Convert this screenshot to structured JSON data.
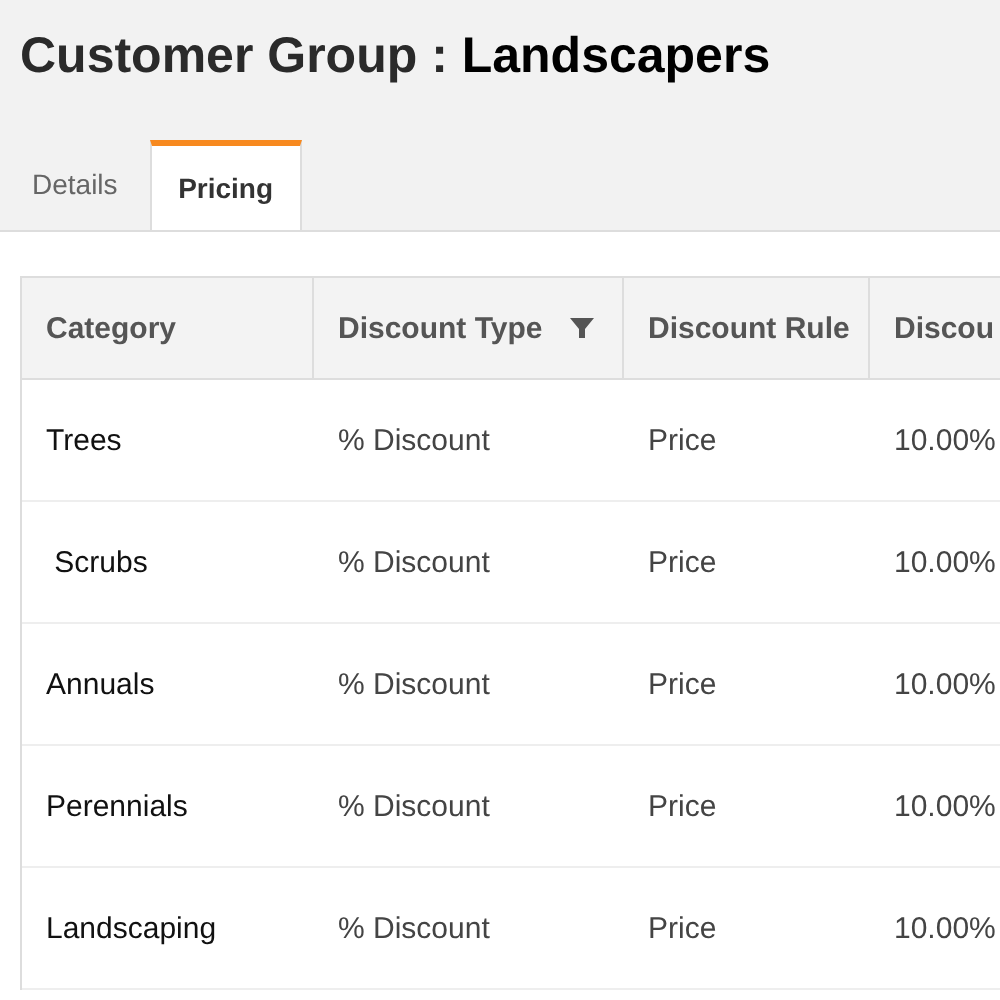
{
  "title": {
    "label": "Customer Group :",
    "name": "Landscapers"
  },
  "tabs": [
    {
      "label": "Details",
      "selected": false
    },
    {
      "label": "Pricing",
      "selected": true
    }
  ],
  "table": {
    "columns": [
      {
        "label": "Category",
        "filter": false
      },
      {
        "label": "Discount Type",
        "filter": true
      },
      {
        "label": "Discount Rule",
        "filter": false
      },
      {
        "label": "Discou",
        "filter": false
      }
    ],
    "rows": [
      [
        "Trees",
        "% Discount",
        "Price",
        "10.00%"
      ],
      [
        " Scrubs",
        "% Discount",
        "Price",
        "10.00%"
      ],
      [
        "Annuals",
        "% Discount",
        "Price",
        "10.00%"
      ],
      [
        "Perennials",
        "% Discount",
        "Price",
        "10.00%"
      ],
      [
        "Landscaping",
        "% Discount",
        "Price",
        "10.00%"
      ]
    ]
  }
}
